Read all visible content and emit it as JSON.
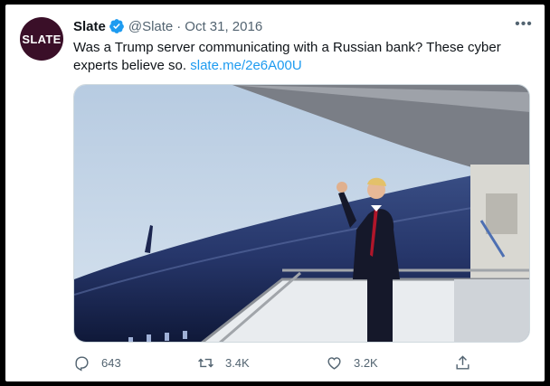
{
  "tweet": {
    "author_name": "Slate",
    "author_handle": "@Slate",
    "separator": "·",
    "date": "Oct 31, 2016",
    "avatar_text": "SLATE",
    "text_body": "Was a Trump server communicating with a Russian bank? These cyber experts believe so. ",
    "link": "slate.me/2e6A00U",
    "more_label": "•••"
  },
  "actions": {
    "replies": "643",
    "retweets": "3.4K",
    "likes": "3.2K"
  },
  "icons": {
    "verified": "verified-badge-icon",
    "reply": "reply-icon",
    "retweet": "retweet-icon",
    "like": "heart-icon",
    "share": "share-icon",
    "more": "more-icon"
  },
  "colors": {
    "link": "#1d9bf0",
    "verified": "#1d9bf0",
    "avatar_bg": "#3a0f28",
    "secondary_text": "#536471"
  }
}
